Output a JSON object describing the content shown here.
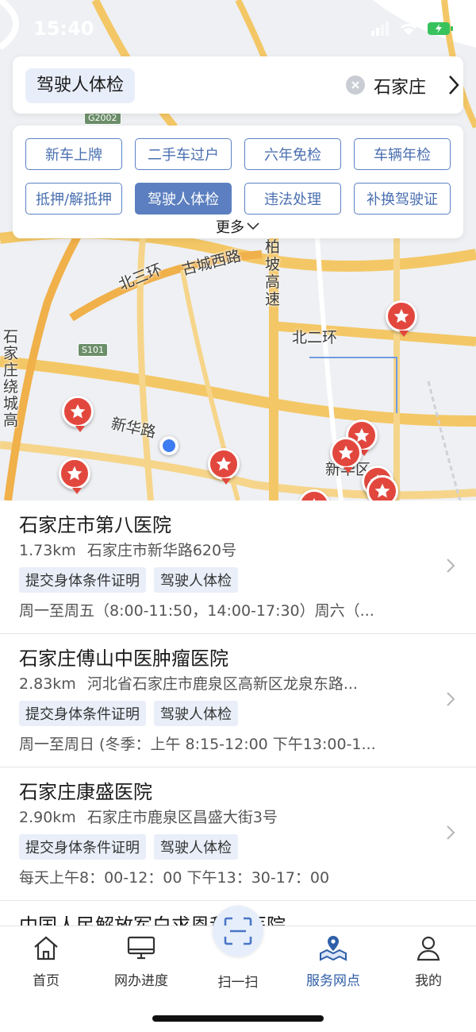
{
  "status_bar": {
    "time": "15:40"
  },
  "search": {
    "keyword": "驾驶人体检",
    "city": "石家庄"
  },
  "categories": {
    "items": [
      {
        "label": "新车上牌",
        "active": false
      },
      {
        "label": "二手车过户",
        "active": false
      },
      {
        "label": "六年免检",
        "active": false
      },
      {
        "label": "车辆年检",
        "active": false
      },
      {
        "label": "抵押/解抵押",
        "active": false
      },
      {
        "label": "驾驶人体检",
        "active": true
      },
      {
        "label": "违法处理",
        "active": false
      },
      {
        "label": "补换驾驶证",
        "active": false
      }
    ],
    "more_label": "更多"
  },
  "map": {
    "labels": {
      "north_third_ring": "北三环",
      "gucheng_west_rd": "古城西路",
      "bo_expressway": "柏坡高速",
      "north_second_ring": "北二环",
      "ring_expressway": "石家庄绕城高",
      "xinhua_rd": "新华路",
      "xinhua_district": "新华区"
    },
    "shields": {
      "g2002": "G2002",
      "s101": "S101"
    }
  },
  "sites": [
    {
      "name": "石家庄市第八医院",
      "distance": "1.73km",
      "address": "石家庄市新华路620号",
      "tags": [
        "提交身体条件证明",
        "驾驶人体检"
      ],
      "hours": "周一至周五（8:00-11:50，14:00-17:30）周六（..."
    },
    {
      "name": "石家庄傅山中医肿瘤医院",
      "distance": "2.83km",
      "address": "河北省石家庄市鹿泉区高新区龙泉东路...",
      "tags": [
        "提交身体条件证明",
        "驾驶人体检"
      ],
      "hours": "周一至周日 (冬季：上午 8:15-12:00 下午13:00-1..."
    },
    {
      "name": "石家庄康盛医院",
      "distance": "2.90km",
      "address": "石家庄市鹿泉区昌盛大街3号",
      "tags": [
        "提交身体条件证明",
        "驾驶人体检"
      ],
      "hours": "每天上午8：00-12：00 下午13：30-17：00"
    },
    {
      "name": "中国人民解放军白求恩和平医院",
      "distance": "",
      "address": "",
      "tags": [],
      "hours": ""
    }
  ],
  "tabbar": {
    "home": "首页",
    "progress": "网办进度",
    "scan": "扫一扫",
    "service": "服务网点",
    "mine": "我的"
  },
  "colors": {
    "accent": "#2f5fa8",
    "chip_border": "#5b82c4",
    "chip_active": "#5b7fc0",
    "pin": "#e2473e",
    "tag_bg": "#e9eef8"
  }
}
